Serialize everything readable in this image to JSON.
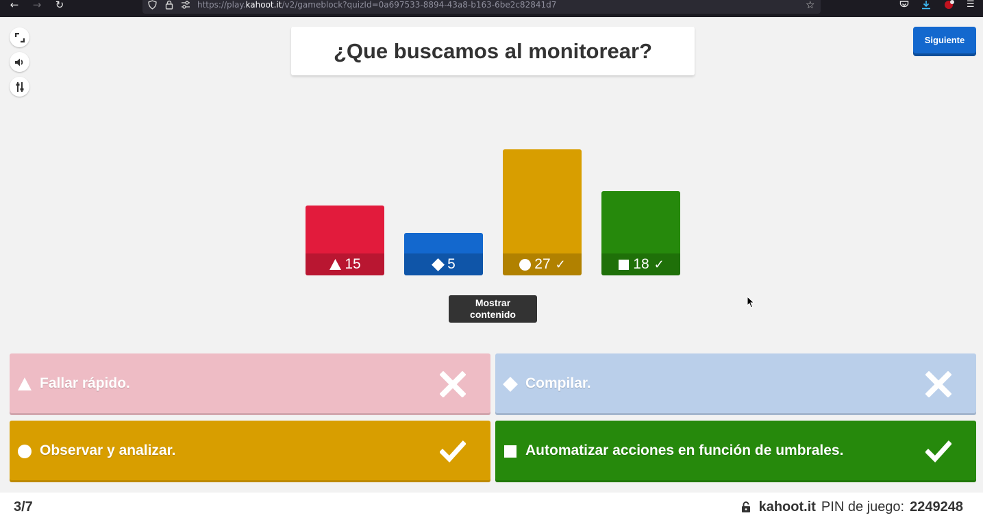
{
  "browser": {
    "url_prefix": "https://play.",
    "url_domain": "kahoot.it",
    "url_path": "/v2/gameblock?quizId=0a697533-8894-43a8-b163-6be2c82841d7"
  },
  "question": {
    "text": "¿Que buscamos al monitorear?"
  },
  "toolbar": {
    "next_label": "Siguiente"
  },
  "chart_data": {
    "type": "bar",
    "categories": [
      "triangle",
      "diamond",
      "circle",
      "square"
    ],
    "values": [
      15,
      5,
      27,
      18
    ],
    "correct": [
      false,
      false,
      true,
      true
    ],
    "colors": [
      "#e21b3c",
      "#1368ce",
      "#d89e00",
      "#26890c"
    ],
    "labels": [
      "15",
      "5",
      "27",
      "18"
    ],
    "check_glyph": "✓"
  },
  "show_content": {
    "line1": "Mostrar",
    "line2": "contenido"
  },
  "answers": [
    {
      "text": "Fallar rápido.",
      "shape": "triangle-icon",
      "correct": false,
      "color": "#eebcc5"
    },
    {
      "text": "Compilar.",
      "shape": "diamond-icon",
      "correct": false,
      "color": "#bacfea"
    },
    {
      "text": "Observar y analizar.",
      "shape": "circle-icon",
      "correct": true,
      "color": "#d89e00"
    },
    {
      "text": "Automatizar acciones en función de umbrales.",
      "shape": "square-icon",
      "correct": true,
      "color": "#26890c"
    }
  ],
  "footer": {
    "progress": "3/7",
    "site": "kahoot.it",
    "pin_label": "PIN de juego:",
    "pin_value": "2249248"
  }
}
